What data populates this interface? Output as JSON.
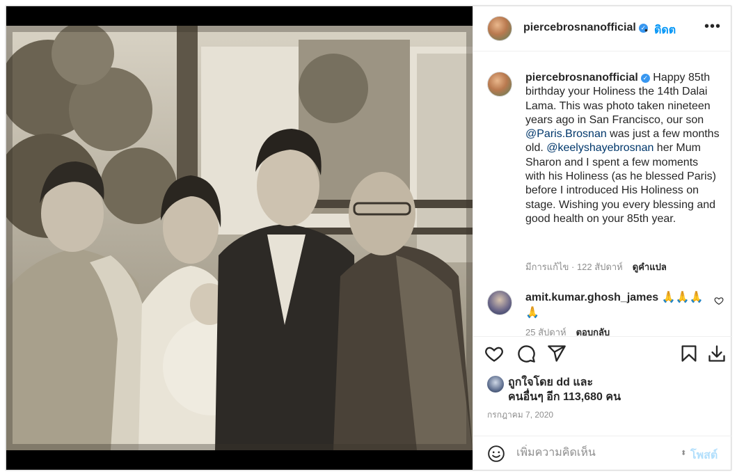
{
  "post": {
    "username": "piercebrosnanofficial",
    "follow_label": "ติดต",
    "more_label": "•••",
    "separator": "•"
  },
  "caption": {
    "username": "piercebrosnanofficial",
    "text_1": "Happy 85th birthday your Holiness the 14th Dalai Lama. This was photo taken nineteen years ago in San Francisco, our son ",
    "mention_1": "@Paris.Brosnan",
    "text_2": " was just a few months old. ",
    "mention_2": "@keelyshayebrosnan",
    "text_3": " her Mum Sharon and I spent a few moments with his Holiness (as he blessed Paris) before I introduced His Holiness on stage. Wishing you every blessing and good health on your 85th year.",
    "edited_label": "มีการแก้ไข · 122 สัปดาห์",
    "translate_label": "ดูคำแปล"
  },
  "comment": {
    "username": "amit.kumar.ghosh_james",
    "text": "🙏🙏🙏🙏",
    "time": "25 สัปดาห์",
    "reply_label": "ตอบกลับ"
  },
  "likes": {
    "line_1": "ถูกใจโดย dd และ",
    "line_2": "คนอื่นๆ อีก 113,680 คน"
  },
  "date": "กรกฎาคม 7, 2020",
  "add_comment": {
    "placeholder": "เพิ่มความคิดเห็น",
    "post_label": "โพสต์"
  },
  "icons": [
    "more-icon",
    "verified-icon",
    "heart-icon",
    "comment-icon",
    "share-icon",
    "bookmark-icon",
    "download-icon",
    "emoji-icon",
    "small-heart-icon"
  ],
  "colors": {
    "link": "#0095f6",
    "mention": "#00376b",
    "secondary": "#8e8e8e",
    "verified": "#3897f0",
    "post_disabled": "#b2dffc"
  }
}
